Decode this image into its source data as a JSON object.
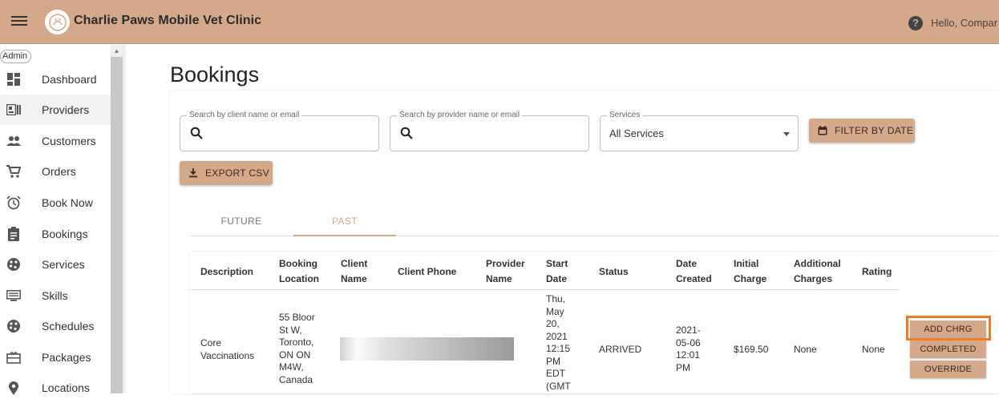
{
  "header": {
    "title": "Charlie Paws Mobile Vet Clinic",
    "greeting": "Hello, Compar",
    "help_icon": "?",
    "color": "#d4a98a"
  },
  "sidebar": {
    "role_badge": "Admin",
    "items": [
      {
        "label": "Dashboard",
        "icon": "dashboard-icon"
      },
      {
        "label": "Providers",
        "icon": "id-card-icon"
      },
      {
        "label": "Customers",
        "icon": "people-icon"
      },
      {
        "label": "Orders",
        "icon": "cart-icon"
      },
      {
        "label": "Book Now",
        "icon": "alarm-clock-icon"
      },
      {
        "label": "Bookings",
        "icon": "clipboard-icon"
      },
      {
        "label": "Services",
        "icon": "palette-icon"
      },
      {
        "label": "Skills",
        "icon": "list-icon"
      },
      {
        "label": "Schedules",
        "icon": "palette-icon"
      },
      {
        "label": "Packages",
        "icon": "package-icon"
      },
      {
        "label": "Locations",
        "icon": "location-icon"
      }
    ],
    "active": "Providers"
  },
  "main": {
    "title": "Bookings",
    "filters": {
      "client_search_label": "Search by client name or email",
      "provider_search_label": "Search by provider name or email",
      "services_label": "Services",
      "services_value": "All Services",
      "filter_by_date": "FILTER BY DATE",
      "export_csv": "EXPORT CSV"
    },
    "tabs": [
      {
        "label": "FUTURE",
        "selected": false
      },
      {
        "label": "PAST",
        "selected": true
      }
    ],
    "table": {
      "headers": {
        "description": "Description",
        "booking_location": "Booking Location",
        "client_name": "Client Name",
        "client_phone": "Client Phone",
        "provider_name": "Provider Name",
        "start_date": "Start Date",
        "status": "Status",
        "date_created": "Date Created",
        "initial_charge": "Initial Charge",
        "additional_charges": "Additional Charges",
        "rating": "Rating"
      },
      "rows": [
        {
          "description": "Core Vaccinations",
          "booking_location": "55 Bloor St W, Toronto, ON ON M4W, Canada",
          "start_date": "Thu, May 20, 2021 12:15 PM EDT (GMT",
          "status": "ARRIVED",
          "date_created": "2021-05-06 12:01 PM",
          "initial_charge": "$169.50",
          "additional_charges": "None",
          "rating": "None",
          "actions": {
            "add_charge": "ADD CHRG",
            "completed": "COMPLETED",
            "override": "OVERRIDE"
          }
        }
      ]
    }
  }
}
